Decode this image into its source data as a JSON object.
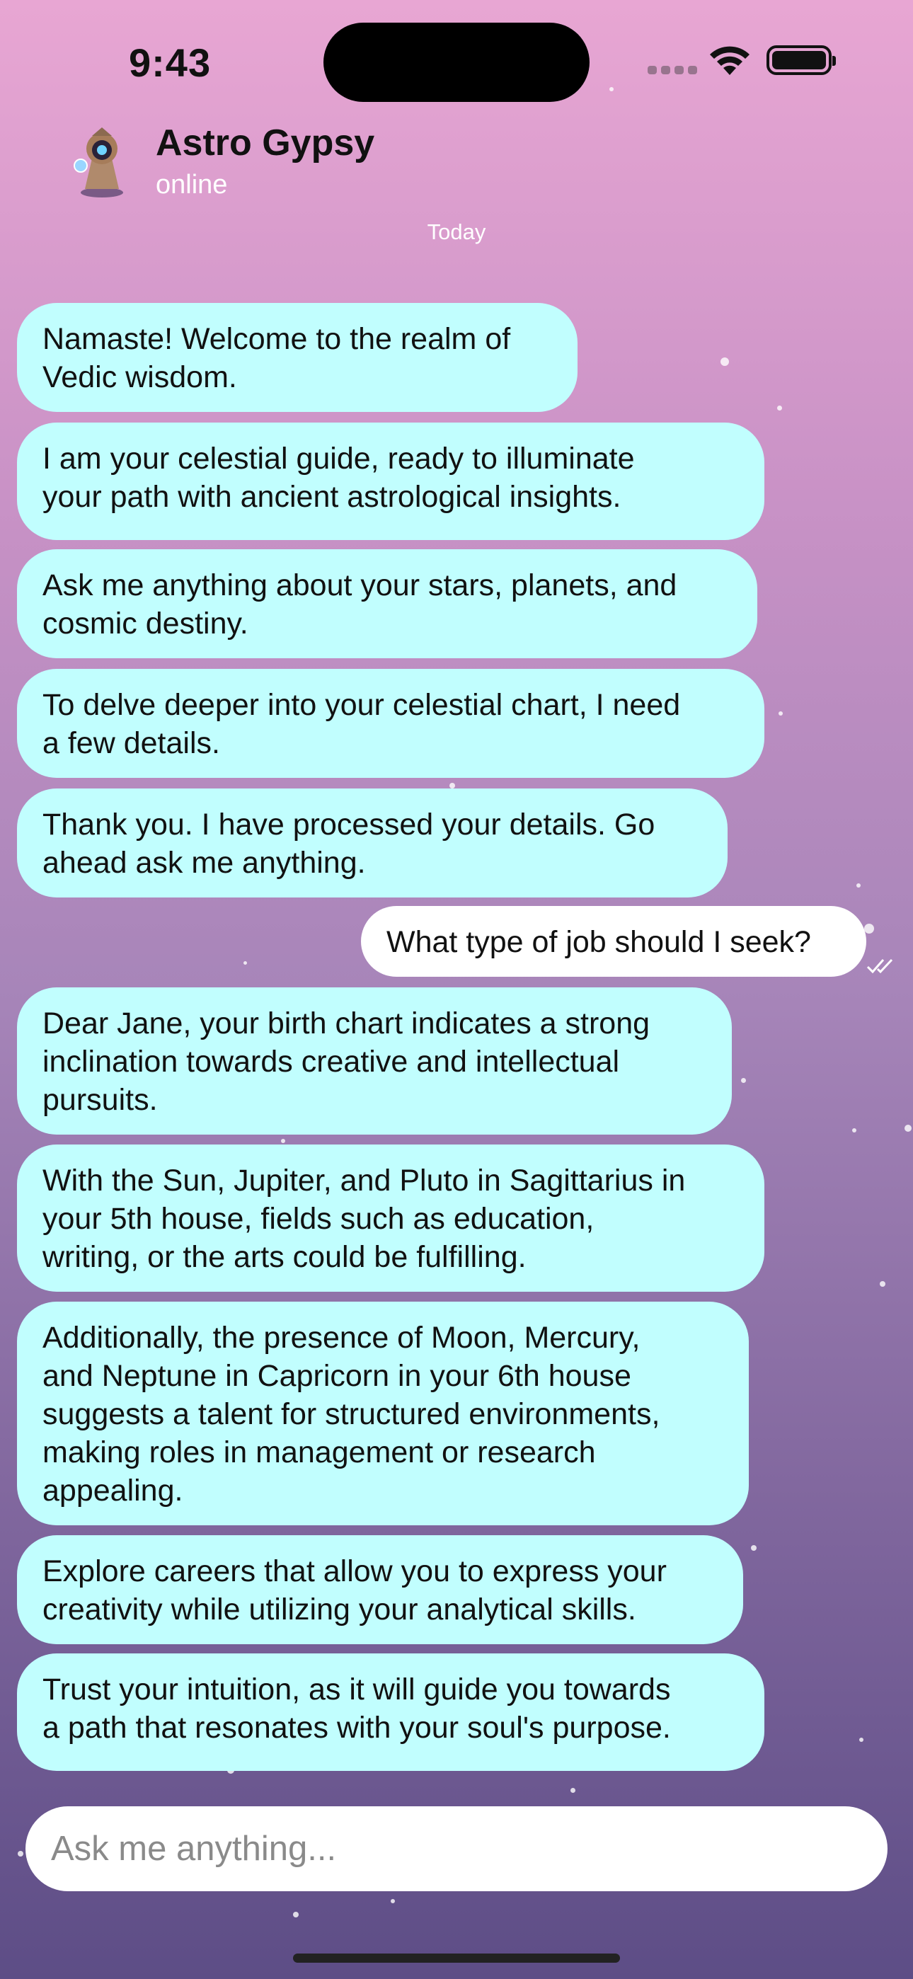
{
  "status_bar": {
    "time": "9:43"
  },
  "header": {
    "title": "Astro Gypsy",
    "subtitle": "online"
  },
  "date_divider": "Today",
  "messages": [
    {
      "sender": "bot",
      "text": "Namaste! Welcome to the realm of\nVedic wisdom."
    },
    {
      "sender": "bot",
      "text": "I am your celestial guide, ready to illuminate\nyour path with ancient astrological insights."
    },
    {
      "sender": "bot",
      "text": "Ask me anything about your stars, planets, and\ncosmic destiny."
    },
    {
      "sender": "bot",
      "text": "To delve deeper into your celestial chart, I need\na few details."
    },
    {
      "sender": "bot",
      "text": "Thank you. I have processed your details. Go\nahead ask me anything."
    },
    {
      "sender": "user",
      "text": "What type of job should I seek?"
    },
    {
      "sender": "bot",
      "text": "Dear Jane, your birth chart indicates a strong\ninclination towards creative and intellectual\npursuits."
    },
    {
      "sender": "bot",
      "text": "With the Sun, Jupiter, and Pluto in Sagittarius in\nyour 5th house, fields such as education,\nwriting, or the arts could be fulfilling."
    },
    {
      "sender": "bot",
      "text": "Additionally, the presence of Moon, Mercury,\nand Neptune in Capricorn in your 6th house\nsuggests a talent for structured environments,\nmaking roles in management or research\nappealing."
    },
    {
      "sender": "bot",
      "text": "Explore careers that allow you to express your\ncreativity while utilizing your analytical skills."
    },
    {
      "sender": "bot",
      "text": "Trust your intuition, as it will guide you towards\na path that resonates with your soul's purpose."
    }
  ],
  "composer": {
    "placeholder": "Ask me anything..."
  },
  "colors": {
    "bot_bubble": "#c1fefe",
    "user_bubble": "#ffffff"
  },
  "icons": {
    "read_receipt": "double-check-icon",
    "wifi": "wifi-icon",
    "battery": "battery-icon"
  }
}
